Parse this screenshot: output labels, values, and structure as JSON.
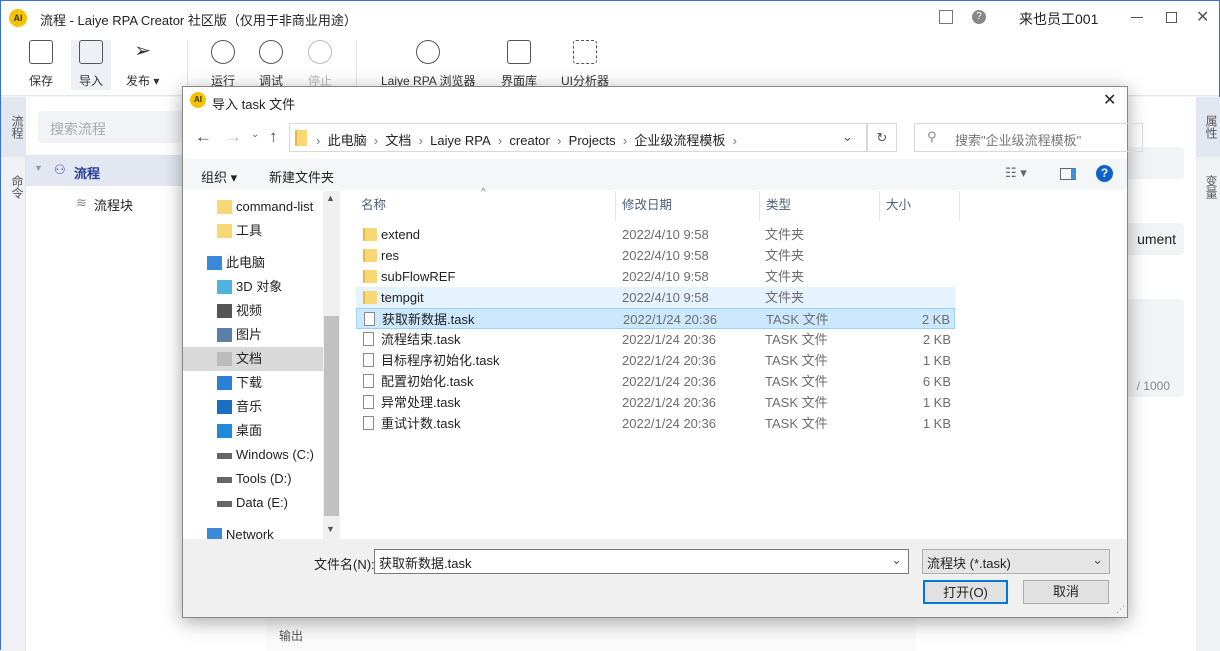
{
  "app": {
    "title": "流程 - Laiye RPA Creator 社区版（仅用于非商业用途）",
    "user": "来也员工001",
    "logo_text": "AI"
  },
  "toolbar": {
    "save": "保存",
    "import": "导入",
    "publish": "发布",
    "run": "运行",
    "debug": "调试",
    "stop": "停止",
    "browser": "Laiye RPA 浏览器",
    "uilib": "界面库",
    "analyzer": "UI分析器"
  },
  "left_tabs": [
    "流程",
    "命令"
  ],
  "right_tabs": [
    "属性",
    "变量"
  ],
  "left_panel": {
    "search_placeholder": "搜索流程",
    "tree": [
      {
        "label": "流程"
      },
      {
        "label": "流程块"
      }
    ]
  },
  "main": {
    "output_label": "输出"
  },
  "right_panel": {
    "field_text": "ument",
    "counter": "/ 1000"
  },
  "dialog": {
    "title": "导入 task 文件",
    "breadcrumb": [
      "此电脑",
      "文档",
      "Laiye RPA",
      "creator",
      "Projects",
      "企业级流程模板"
    ],
    "search_placeholder": "搜索\"企业级流程模板\"",
    "organize": "组织",
    "new_folder": "新建文件夹",
    "nav": [
      {
        "label": "command-list",
        "icon": "folder-icon"
      },
      {
        "label": "工具",
        "icon": "folder-icon"
      },
      {
        "label": "此电脑",
        "icon": "computer-icon"
      },
      {
        "label": "3D 对象",
        "icon": "3d-objects-icon"
      },
      {
        "label": "视频",
        "icon": "video-icon"
      },
      {
        "label": "图片",
        "icon": "pictures-icon"
      },
      {
        "label": "文档",
        "icon": "documents-icon",
        "selected": true
      },
      {
        "label": "下载",
        "icon": "download-icon"
      },
      {
        "label": "音乐",
        "icon": "music-icon"
      },
      {
        "label": "桌面",
        "icon": "desktop-icon"
      },
      {
        "label": "Windows (C:)",
        "icon": "drive-icon"
      },
      {
        "label": "Tools (D:)",
        "icon": "drive-icon"
      },
      {
        "label": "Data (E:)",
        "icon": "drive-icon"
      },
      {
        "label": "Network",
        "icon": "network-icon"
      }
    ],
    "columns": [
      "名称",
      "修改日期",
      "类型",
      "大小"
    ],
    "files": [
      {
        "name": "extend",
        "date": "2022/4/10 9:58",
        "type": "文件夹",
        "size": "",
        "kind": "folder"
      },
      {
        "name": "res",
        "date": "2022/4/10 9:58",
        "type": "文件夹",
        "size": "",
        "kind": "folder"
      },
      {
        "name": "subFlowREF",
        "date": "2022/4/10 9:58",
        "type": "文件夹",
        "size": "",
        "kind": "folder"
      },
      {
        "name": "tempgit",
        "date": "2022/4/10 9:58",
        "type": "文件夹",
        "size": "",
        "kind": "folder",
        "state": "hover"
      },
      {
        "name": "获取新数据.task",
        "date": "2022/1/24 20:36",
        "type": "TASK 文件",
        "size": "2 KB",
        "kind": "file",
        "state": "selected"
      },
      {
        "name": "流程结束.task",
        "date": "2022/1/24 20:36",
        "type": "TASK 文件",
        "size": "2 KB",
        "kind": "file"
      },
      {
        "name": "目标程序初始化.task",
        "date": "2022/1/24 20:36",
        "type": "TASK 文件",
        "size": "1 KB",
        "kind": "file"
      },
      {
        "name": "配置初始化.task",
        "date": "2022/1/24 20:36",
        "type": "TASK 文件",
        "size": "6 KB",
        "kind": "file"
      },
      {
        "name": "异常处理.task",
        "date": "2022/1/24 20:36",
        "type": "TASK 文件",
        "size": "1 KB",
        "kind": "file"
      },
      {
        "name": "重试计数.task",
        "date": "2022/1/24 20:36",
        "type": "TASK 文件",
        "size": "1 KB",
        "kind": "file"
      }
    ],
    "filename_label": "文件名(N):",
    "filename_value": "获取新数据.task",
    "filter": "流程块 (*.task)",
    "open": "打开(O)",
    "cancel": "取消"
  },
  "colors": {
    "accent": "#3b6fd8",
    "selection": "#cce8ff",
    "folder": "#f8d775"
  }
}
